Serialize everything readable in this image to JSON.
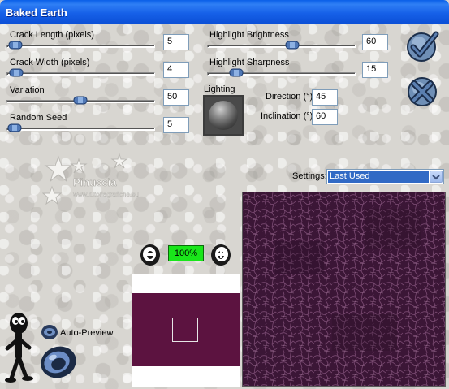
{
  "window": {
    "title": "Baked Earth"
  },
  "sliders": [
    {
      "label": "Crack Length (pixels)",
      "value": "5",
      "level": 0.05
    },
    {
      "label": "Crack Width (pixels)",
      "value": "4",
      "level": 0.04
    },
    {
      "label": "Variation",
      "value": "50",
      "level": 0.5
    },
    {
      "label": "Random Seed",
      "value": "5",
      "level": 0.02
    },
    {
      "label": "Highlight Brightness",
      "value": "60",
      "level": 0.6
    },
    {
      "label": "Highlight Sharpness",
      "value": "15",
      "level": 0.15
    }
  ],
  "lighting": {
    "label": "Lighting",
    "direction_label": "Direction (°)",
    "direction_value": "45",
    "inclination_label": "Inclination (°)",
    "inclination_value": "60"
  },
  "settings": {
    "label": "Settings:",
    "value": "Last Used"
  },
  "zoom": {
    "value": "100%"
  },
  "auto_preview": {
    "label": "Auto-Preview"
  },
  "watermark": {
    "text": "Pinuccia",
    "subtext": "www.tutoriagrafiche.eu"
  },
  "colors": {
    "preview_fill": "#5c1340",
    "texture_fill": "#3b1636",
    "title_bar": "#0b4fd6"
  },
  "icons": {
    "ok": "checkmark-icon",
    "cancel": "cross-icon",
    "zoom_in": "zoom-in-icon",
    "zoom_out": "zoom-out-icon",
    "help": "help-figure-icon",
    "eye": "eye-icon"
  }
}
